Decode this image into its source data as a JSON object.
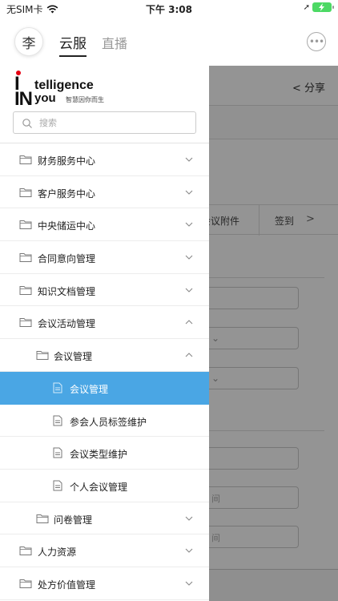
{
  "status_bar": {
    "carrier": "无SIM卡",
    "time": "下午 3:08",
    "wifi_icon": "wifi-icon",
    "battery_icon": "battery-charging-icon"
  },
  "top_nav": {
    "avatar_text": "李",
    "tab_cloud": "云服",
    "tab_live": "直播",
    "message_icon": "chat-bubble-icon"
  },
  "background_page": {
    "share_label": "分享",
    "tab_attachments": "会议附件",
    "tab_signin": "签到",
    "field_hint_1": "间",
    "field_hint_2": "间"
  },
  "drawer": {
    "logo": {
      "line1": "telligence",
      "line2": "you",
      "prefix": "IN",
      "tagline": "智慧因你而生"
    },
    "search_placeholder": "搜索",
    "menu": [
      {
        "label": "财务服务中心",
        "level": 1,
        "type": "folder",
        "expanded": false
      },
      {
        "label": "客户服务中心",
        "level": 1,
        "type": "folder",
        "expanded": false
      },
      {
        "label": "中央储运中心",
        "level": 1,
        "type": "folder",
        "expanded": false
      },
      {
        "label": "合同意向管理",
        "level": 1,
        "type": "folder",
        "expanded": false
      },
      {
        "label": "知识文档管理",
        "level": 1,
        "type": "folder",
        "expanded": false
      },
      {
        "label": "会议活动管理",
        "level": 1,
        "type": "folder",
        "expanded": true
      },
      {
        "label": "会议管理",
        "level": 2,
        "type": "folder",
        "expanded": true
      },
      {
        "label": "会议管理",
        "level": 3,
        "type": "file",
        "active": true
      },
      {
        "label": "参会人员标签维护",
        "level": 3,
        "type": "file"
      },
      {
        "label": "会议类型维护",
        "level": 3,
        "type": "file"
      },
      {
        "label": "个人会议管理",
        "level": 3,
        "type": "file"
      },
      {
        "label": "问卷管理",
        "level": 2,
        "type": "folder",
        "expanded": false
      },
      {
        "label": "人力资源",
        "level": 1,
        "type": "folder",
        "expanded": false
      },
      {
        "label": "处方价值管理",
        "level": 1,
        "type": "folder",
        "expanded": false
      }
    ]
  },
  "colors": {
    "active_item_bg": "#4aa6e4",
    "logo_dot": "#e60012",
    "battery": "#4cd964"
  }
}
